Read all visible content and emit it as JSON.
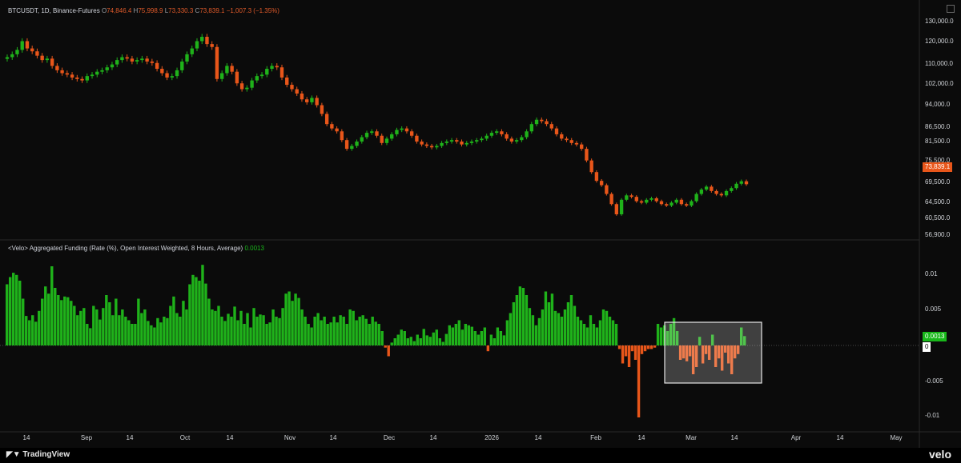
{
  "price_legend": {
    "symbol": "BTCUSDT, 1D, Binance-Futures",
    "o_key": "O",
    "o_val": "74,846.4",
    "h_key": "H",
    "h_val": "75,998.9",
    "l_key": "L",
    "l_val": "73,330.3",
    "c_key": "C",
    "c_val": "73,839.1",
    "chg": "−1,007.3 (−1.35%)"
  },
  "funding_legend": {
    "title": "<Velo> Aggregated Funding (Rate (%), Open Interest Weighted, 8 Hours, Average)",
    "value": "0.0013"
  },
  "price_axis": [
    "130,000.0",
    "120,000.0",
    "110,000.0",
    "102,000.0",
    "94,000.0",
    "86,500.0",
    "81,500.0",
    "75,500.0",
    "69,500.0",
    "64,500.0",
    "60,500.0",
    "56,900.0"
  ],
  "funding_axis": [
    "0.01",
    "0.005",
    "-0.005",
    "-0.01"
  ],
  "price_tag": "73,839.1",
  "funding_tag": "0.0013",
  "zero_tag": "0",
  "time_axis": [
    "14",
    "Sep",
    "14",
    "Oct",
    "14",
    "Nov",
    "14",
    "Dec",
    "14",
    "2026",
    "14",
    "Feb",
    "14",
    "Mar",
    "14",
    "Apr",
    "14",
    "May"
  ],
  "footer": {
    "tradingview": "TradingView",
    "velo": "velo"
  },
  "colors": {
    "up": "#1fb21a",
    "down": "#e8561a",
    "bg": "#0b0b0b"
  },
  "chart_data": [
    {
      "type": "candlestick",
      "title": "BTCUSDT, 1D, Binance-Futures",
      "ylim": [
        56900,
        130000
      ],
      "close_series_approx": [
        117500,
        118500,
        120000,
        123000,
        120500,
        119500,
        118000,
        116500,
        117000,
        114500,
        113000,
        112000,
        111500,
        110500,
        110000,
        109500,
        111000,
        111500,
        112500,
        113000,
        114000,
        115000,
        116500,
        117500,
        117000,
        116000,
        116500,
        117000,
        116000,
        115500,
        113500,
        112000,
        110500,
        111000,
        113000,
        116000,
        118500,
        120500,
        123000,
        124500,
        122000,
        121000,
        110000,
        112000,
        114500,
        112500,
        108500,
        106500,
        107000,
        109500,
        111000,
        111500,
        113500,
        114500,
        114000,
        110500,
        108000,
        106500,
        105000,
        103000,
        102000,
        103500,
        101000,
        98000,
        94500,
        93000,
        92000,
        89000,
        86000,
        87000,
        88500,
        90000,
        91500,
        92000,
        90500,
        88000,
        89500,
        91000,
        92500,
        93000,
        92000,
        90500,
        88500,
        87500,
        87000,
        86500,
        87000,
        88000,
        88500,
        89000,
        88500,
        87500,
        88000,
        88500,
        89000,
        89500,
        90500,
        91500,
        92000,
        91000,
        89500,
        88500,
        89000,
        90000,
        92000,
        94500,
        96000,
        95500,
        94500,
        93000,
        91000,
        89500,
        89000,
        88000,
        87500,
        86000,
        82000,
        78000,
        75000,
        73500,
        70500,
        67000,
        63500,
        68500,
        70000,
        69500,
        68000,
        67500,
        68500,
        69000,
        68000,
        67000,
        66500,
        67500,
        68500,
        67000,
        66500,
        68000,
        70500,
        72000,
        73000,
        71500,
        70500,
        70000,
        71500,
        72500,
        74000,
        74846,
        73839
      ]
    },
    {
      "type": "bar",
      "title": "<Velo> Aggregated Funding (Rate (%), Open Interest Weighted, 8 Hours, Average)",
      "ylim": [
        -0.0115,
        0.0115
      ],
      "values": [
        0.0085,
        0.0095,
        0.0101,
        0.0098,
        0.009,
        0.0065,
        0.0041,
        0.0035,
        0.0042,
        0.0033,
        0.0048,
        0.0065,
        0.0082,
        0.0072,
        0.011,
        0.008,
        0.007,
        0.0063,
        0.0068,
        0.0067,
        0.0062,
        0.0055,
        0.0042,
        0.0048,
        0.0052,
        0.003,
        0.0024,
        0.0055,
        0.005,
        0.0036,
        0.0052,
        0.007,
        0.006,
        0.0042,
        0.0065,
        0.0042,
        0.005,
        0.004,
        0.0035,
        0.003,
        0.003,
        0.0065,
        0.0045,
        0.005,
        0.0034,
        0.0028,
        0.0025,
        0.0038,
        0.0032,
        0.004,
        0.0038,
        0.0055,
        0.0068,
        0.0045,
        0.004,
        0.0062,
        0.005,
        0.0085,
        0.0098,
        0.0095,
        0.009,
        0.0112,
        0.0086,
        0.0065,
        0.005,
        0.0048,
        0.0055,
        0.004,
        0.0034,
        0.0044,
        0.004,
        0.0054,
        0.0035,
        0.0048,
        0.003,
        0.0045,
        0.0025,
        0.0052,
        0.004,
        0.0043,
        0.0042,
        0.003,
        0.0032,
        0.005,
        0.004,
        0.0038,
        0.0052,
        0.0072,
        0.0075,
        0.0062,
        0.0072,
        0.0066,
        0.005,
        0.004,
        0.003,
        0.0025,
        0.004,
        0.0045,
        0.0035,
        0.004,
        0.003,
        0.0032,
        0.004,
        0.0032,
        0.0042,
        0.004,
        0.003,
        0.005,
        0.0048,
        0.0035,
        0.004,
        0.0042,
        0.0037,
        0.003,
        0.004,
        0.0033,
        0.003,
        0.002,
        -0.0003,
        -0.0015,
        0.0004,
        0.001,
        0.0015,
        0.0022,
        0.002,
        0.001,
        0.0012,
        0.0006,
        0.0015,
        0.001,
        0.0023,
        0.0014,
        0.0012,
        0.0018,
        0.0022,
        0.001,
        0.0005,
        0.0016,
        0.0028,
        0.0025,
        0.003,
        0.0035,
        0.0022,
        0.003,
        0.0028,
        0.0026,
        0.002,
        0.0015,
        0.002,
        0.0025,
        -0.0008,
        0.0015,
        0.001,
        0.0025,
        0.002,
        0.0014,
        0.0035,
        0.0045,
        0.006,
        0.007,
        0.0082,
        0.008,
        0.007,
        0.0052,
        0.0042,
        0.0028,
        0.0038,
        0.005,
        0.0075,
        0.006,
        0.0072,
        0.0048,
        0.0045,
        0.004,
        0.005,
        0.006,
        0.007,
        0.0055,
        0.004,
        0.0035,
        0.003,
        0.0025,
        0.0042,
        0.003,
        0.0025,
        0.0035,
        0.005,
        0.0048,
        0.004,
        0.0035,
        0.003,
        -0.0005,
        -0.0025,
        -0.0015,
        -0.003,
        -0.0008,
        -0.002,
        -0.01,
        -0.0012,
        -0.0008,
        -0.0005,
        -0.0005,
        -0.0003,
        0.003,
        0.0025,
        0.0028,
        0.002,
        0.003,
        0.0038,
        0.002,
        -0.002,
        -0.0018,
        -0.0022,
        -0.0015,
        -0.004,
        -0.003,
        0.0012,
        -0.0025,
        -0.0012,
        -0.002,
        0.0015,
        -0.003,
        -0.0018,
        -0.0035,
        -0.001,
        -0.0025,
        -0.004,
        -0.0018,
        -0.0012,
        0.0025,
        0.0013
      ]
    }
  ]
}
